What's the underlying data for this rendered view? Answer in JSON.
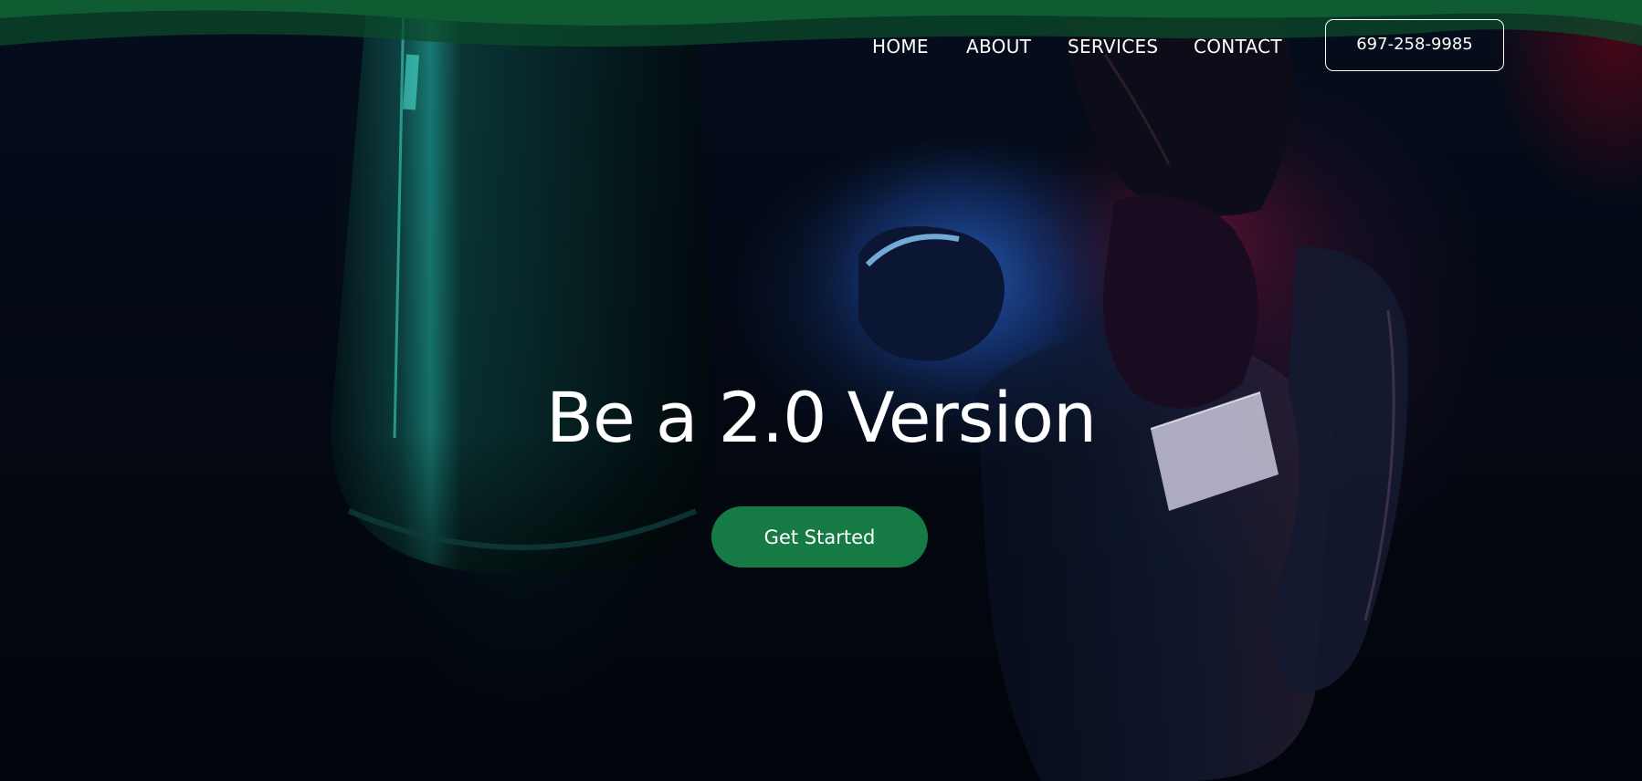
{
  "nav": {
    "links": [
      {
        "label": "HOME"
      },
      {
        "label": "ABOUT"
      },
      {
        "label": "SERVICES"
      },
      {
        "label": "CONTACT"
      }
    ],
    "phone": "697-258-9985"
  },
  "hero": {
    "headline": "Be a 2.0 Version",
    "cta_label": "Get Started"
  },
  "colors": {
    "brand_green": "#167a44",
    "wave_green": "#0f5c33",
    "background": "#02060f"
  }
}
